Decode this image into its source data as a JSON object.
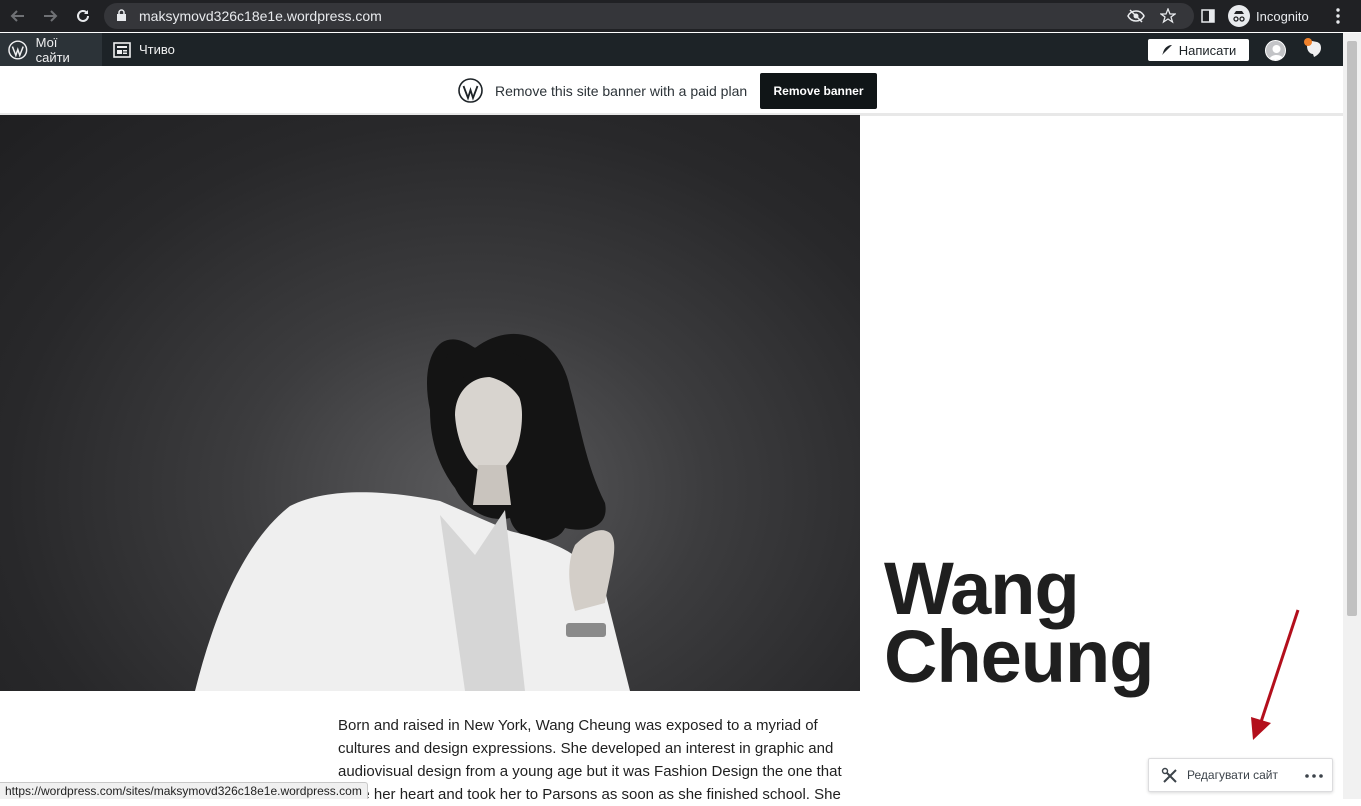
{
  "browser": {
    "url": "maksymovd326c18e1e.wordpress.com",
    "profile_label": "Incognito",
    "status_url": "https://wordpress.com/sites/maksymovd326c18e1e.wordpress.com"
  },
  "adminbar": {
    "my_sites": "Мої сайти",
    "reader": "Чтиво",
    "write": "Написати"
  },
  "banner": {
    "text": "Remove this site banner with a paid plan",
    "button": "Remove banner"
  },
  "site": {
    "title_line1": "Wang",
    "title_line2": "Cheung",
    "bio": "Born and raised in New York, Wang Cheung was exposed to a myriad of cultures and design expressions. She developed an interest in graphic and audiovisual design from a young age but it was Fashion Design the one that stole her heart and took her to Parsons as soon as she finished school. She"
  },
  "edit_site": {
    "label": "Редагувати сайт"
  },
  "colors": {
    "adminbar_bg": "#1d2327",
    "arrow": "#b30f1c"
  }
}
